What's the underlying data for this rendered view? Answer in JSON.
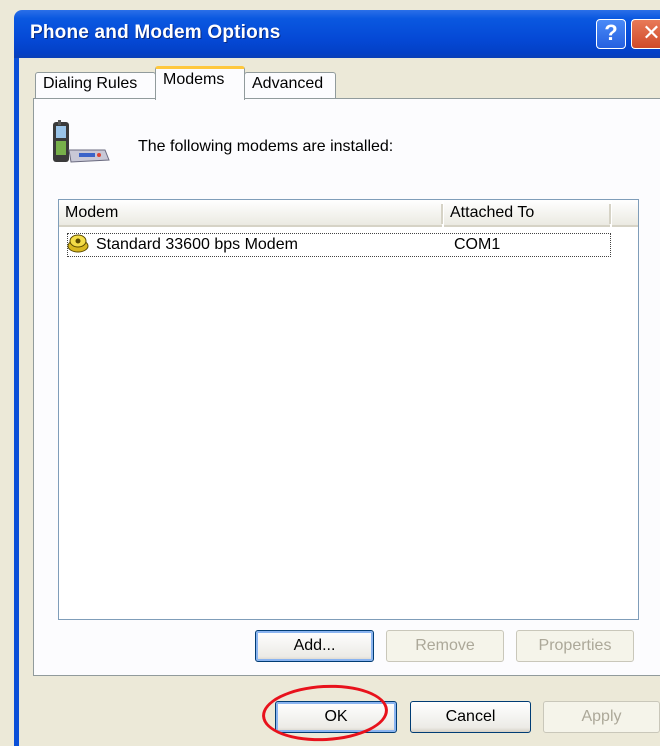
{
  "window": {
    "title": "Phone and Modem Options"
  },
  "tabs": [
    {
      "label": "Dialing Rules"
    },
    {
      "label": "Modems"
    },
    {
      "label": "Advanced"
    }
  ],
  "panel": {
    "intro_text": "The following modems are  installed:"
  },
  "list": {
    "columns": [
      "Modem",
      "Attached To"
    ],
    "rows": [
      {
        "modem": "Standard 33600 bps Modem",
        "attached_to": "COM1"
      }
    ]
  },
  "panel_buttons": {
    "add": "Add...",
    "remove": "Remove",
    "properties": "Properties"
  },
  "dialog_buttons": {
    "ok": "OK",
    "cancel": "Cancel",
    "apply": "Apply"
  },
  "colors": {
    "titlebar": "#0549d6",
    "annotation": "#e8121c",
    "active_tab_accent": "#ffc83c"
  }
}
